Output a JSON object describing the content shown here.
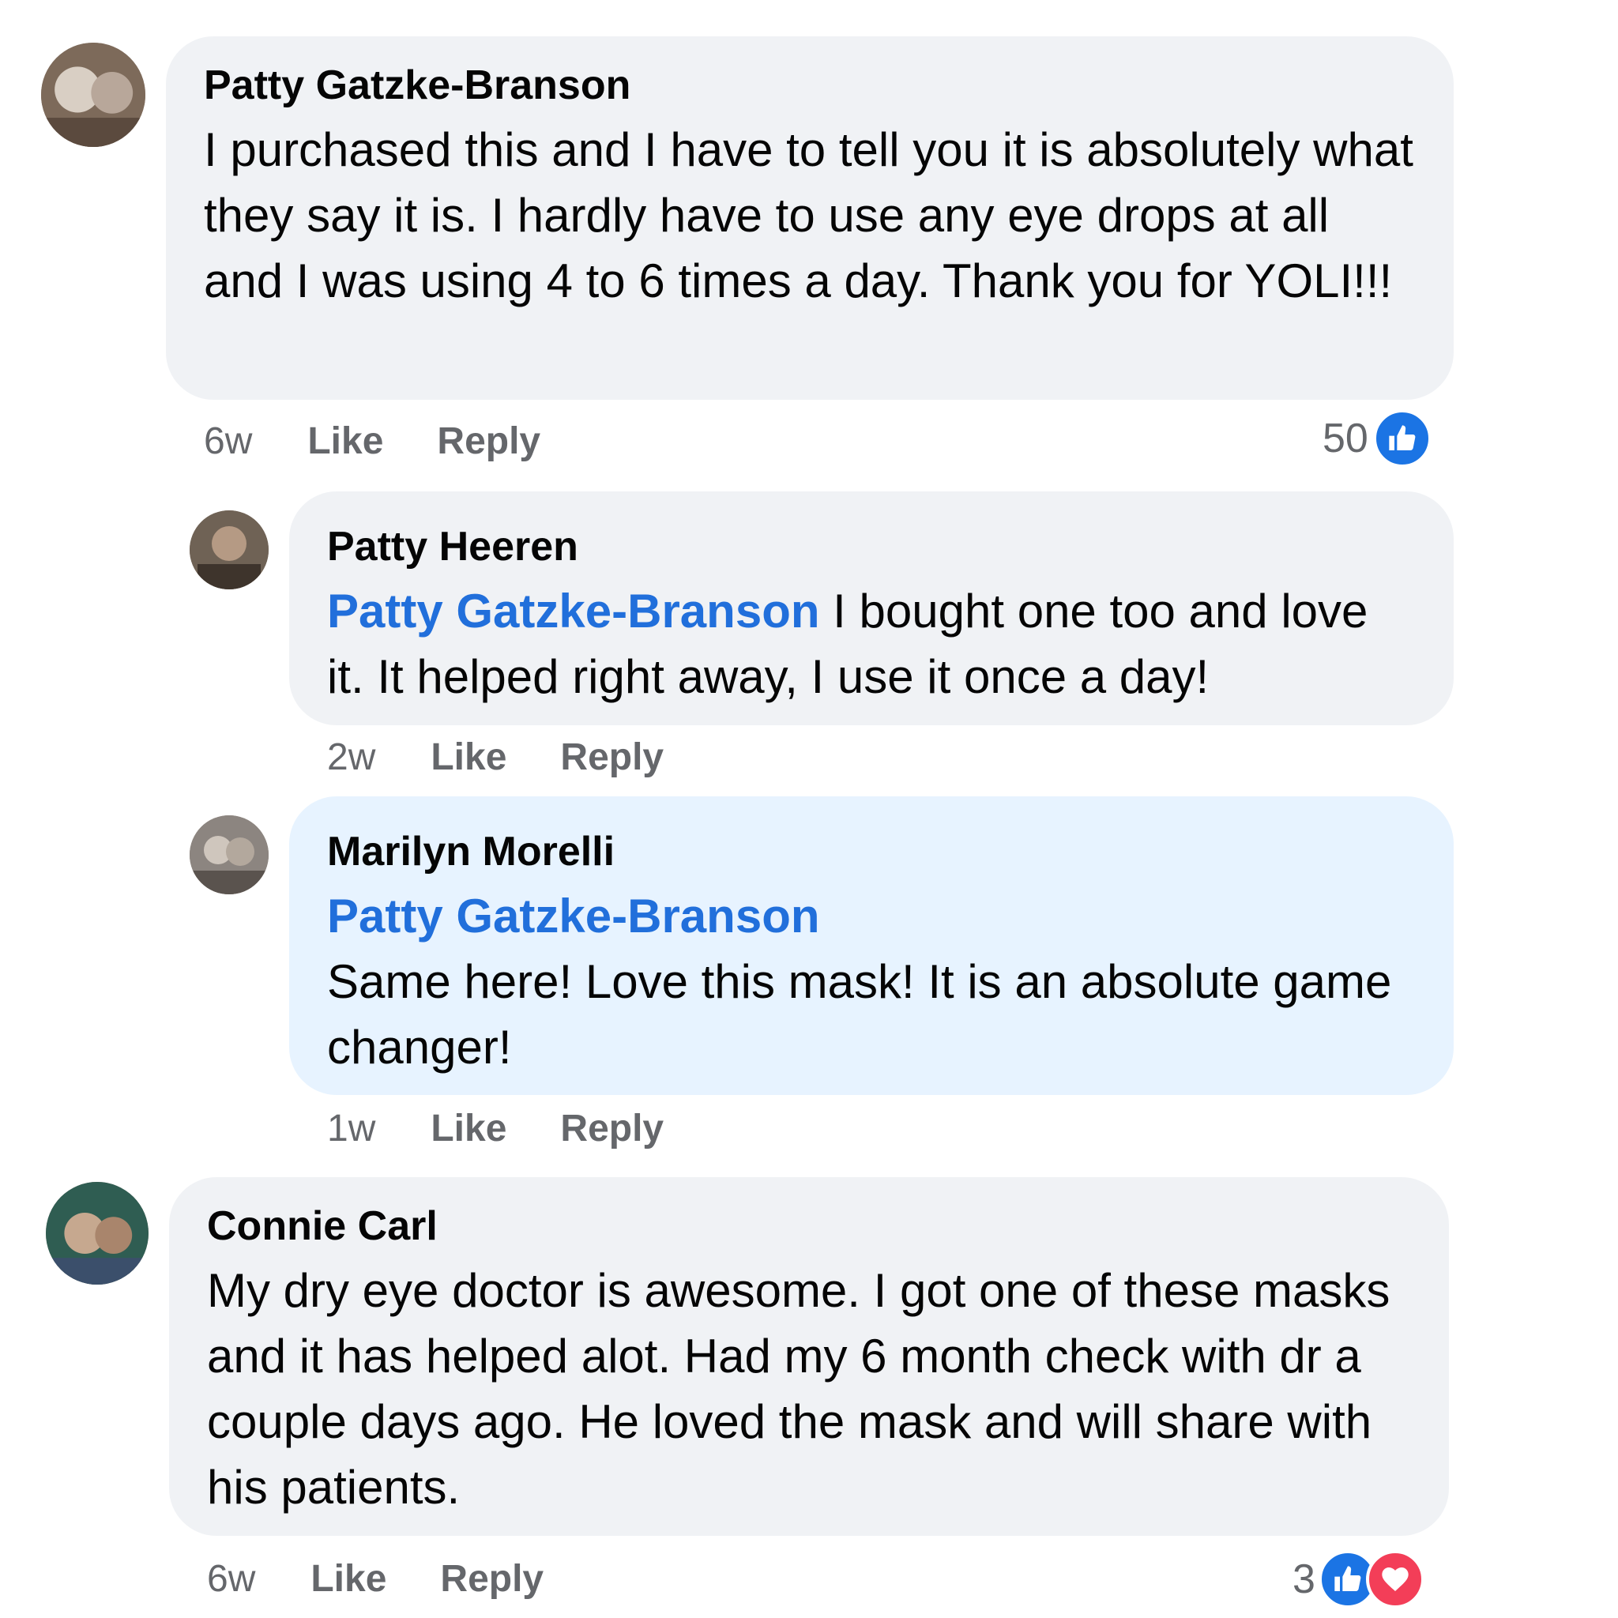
{
  "comments": [
    {
      "author": "Patty Gatzke-Branson",
      "text": "I purchased this and I have to tell you it is absolutely what they say it is. I hardly have to use any eye drops at all and I was using 4 to 6 times a day. Thank you for YOLI!!!",
      "time": "6w",
      "like_label": "Like",
      "reply_label": "Reply",
      "reaction_count": "50",
      "reactions": [
        "like-icon"
      ]
    },
    {
      "author": "Patty Heeren",
      "mention": "Patty Gatzke-Branson",
      "text": "I bought one too and love it. It helped right away, I use it once a day!",
      "time": "2w",
      "like_label": "Like",
      "reply_label": "Reply"
    },
    {
      "author": "Marilyn Morelli",
      "mention": "Patty Gatzke-Branson",
      "text": "Same here! Love this mask! It is an absolute game changer!",
      "time": "1w",
      "like_label": "Like",
      "reply_label": "Reply"
    },
    {
      "author": "Connie Carl",
      "text": "My dry eye doctor is awesome. I got one of these masks and it has helped alot. Had my 6 month check with dr a couple days ago. He loved the mask and will share with his patients.",
      "time": "6w",
      "like_label": "Like",
      "reply_label": "Reply",
      "reaction_count": "3",
      "reactions": [
        "like-icon",
        "love-icon"
      ]
    }
  ],
  "colors": {
    "bubble": "#f0f2f5",
    "highlight_bubble": "#e7f3ff",
    "mention": "#216fdb",
    "meta": "#65676b",
    "like": "#1b74e4",
    "love": "#f33e58"
  }
}
